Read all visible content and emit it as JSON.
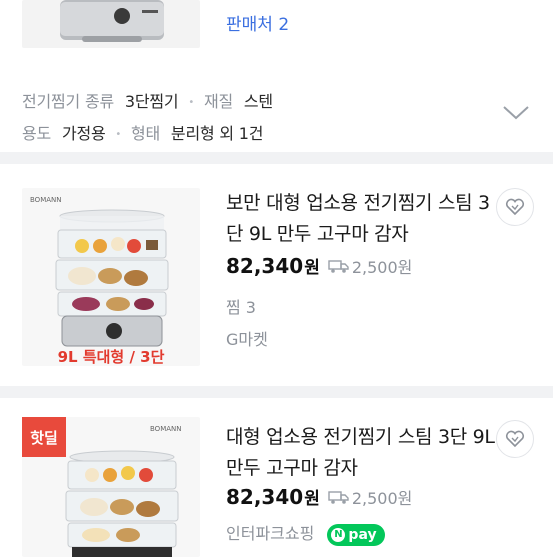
{
  "top_product": {
    "seller_count": "판매처 2"
  },
  "specs": {
    "line1": [
      {
        "label": "전기찜기 종류",
        "value": "3단찜기"
      },
      {
        "label": "재질",
        "value": "스텐"
      }
    ],
    "line2": [
      {
        "label": "용도",
        "value": "가정용"
      },
      {
        "label": "형태",
        "value": "분리형 외 1건"
      }
    ]
  },
  "products": [
    {
      "title": "보만 대형 업소용 전기찜기 스팀 3단 9L 만두 고구마 감자",
      "price": "82,340",
      "currency": "원",
      "shipping": "2,500원",
      "reviews": "찜 3",
      "seller": "G마켓",
      "image_caption": "9L 특대형 / 3단",
      "image_brand": "BOMANN"
    },
    {
      "badge": "핫딜",
      "title": "대형 업소용 전기찜기 스팀 3단 9L 만두 고구마 감자",
      "price": "82,340",
      "currency": "원",
      "shipping": "2,500원",
      "seller": "인터파크쇼핑",
      "pay_badge": "pay",
      "pay_badge_n": "N",
      "image_brand": "BOMANN"
    }
  ],
  "colors": {
    "seller_link": "#3b6fe0",
    "price": "#111111",
    "muted": "#8d929a",
    "hot_deal": "#e84a3c",
    "npay": "#03c75a",
    "divider": "#f1f2f4"
  }
}
